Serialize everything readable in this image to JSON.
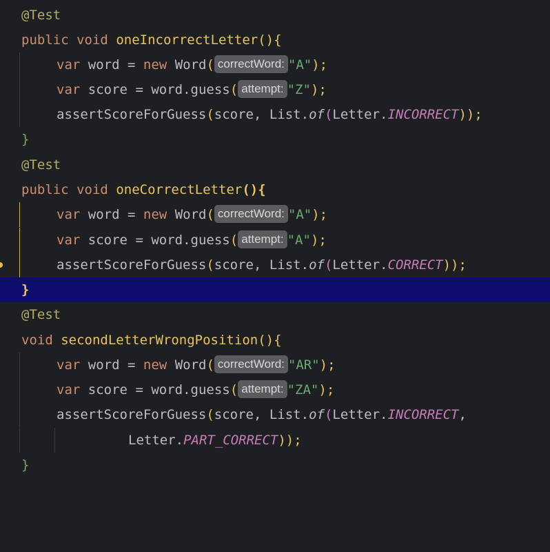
{
  "hint_labels": {
    "correct_word": "correctWord:",
    "attempt": "attempt:"
  },
  "tests": [
    {
      "annotation": "@Test",
      "signature": {
        "modifier": "public",
        "return_type": "void",
        "method": "oneIncorrectLetter",
        "open": "(){"
      },
      "word_line": {
        "kw": "var",
        "name": "word",
        "eq": "=",
        "new": "new",
        "cls": "Word",
        "arg": "\"A\"",
        "close": ");"
      },
      "score_line": {
        "kw": "var",
        "name": "score",
        "eq": "=",
        "call": "word.guess",
        "arg": "\"Z\"",
        "close": ");"
      },
      "assert_line": {
        "call": "assertScoreForGuess",
        "args_prefix": "score, List.",
        "of": "of",
        "letter": "Letter.",
        "constant": "INCORRECT",
        "close": "));"
      },
      "closing": "}"
    },
    {
      "annotation": "@Test",
      "signature": {
        "modifier": "public",
        "return_type": "void",
        "method": "oneCorrectLetter",
        "open": "(){"
      },
      "word_line": {
        "kw": "var",
        "name": "word",
        "eq": "=",
        "new": "new",
        "cls": "Word",
        "arg": "\"A\"",
        "close": ");"
      },
      "score_line": {
        "kw": "var",
        "name": "score",
        "eq": "=",
        "call": "word.guess",
        "arg": "\"A\"",
        "close": ");"
      },
      "assert_line": {
        "call": "assertScoreForGuess",
        "args_prefix": "score, List.",
        "of": "of",
        "letter": "Letter.",
        "constant": "CORRECT",
        "close": "));"
      },
      "closing": "}"
    },
    {
      "annotation": "@Test",
      "signature": {
        "return_type": "void",
        "method": "secondLetterWrongPosition",
        "open": "(){"
      },
      "word_line": {
        "kw": "var",
        "name": "word",
        "eq": "=",
        "new": "new",
        "cls": "Word",
        "arg": "\"AR\"",
        "close": ");"
      },
      "score_line": {
        "kw": "var",
        "name": "score",
        "eq": "=",
        "call": "word.guess",
        "arg": "\"ZA\"",
        "close": ");"
      },
      "assert_line": {
        "call": "assertScoreForGuess",
        "args_prefix": "score, List.",
        "of": "of",
        "letter": "Letter.",
        "constant": "INCORRECT",
        "close": ","
      },
      "continuation": {
        "letter": "Letter.",
        "constant": "PART_CORRECT",
        "close": "));"
      },
      "closing": "}"
    }
  ],
  "colors": {
    "background": "#1e1f22",
    "highlight_line": "#0d0d6b",
    "keyword": "#cf8e6d",
    "method_decl": "#e8c45b",
    "string": "#6aab73",
    "constant": "#c77dbb",
    "annotation": "#b3ae60"
  }
}
